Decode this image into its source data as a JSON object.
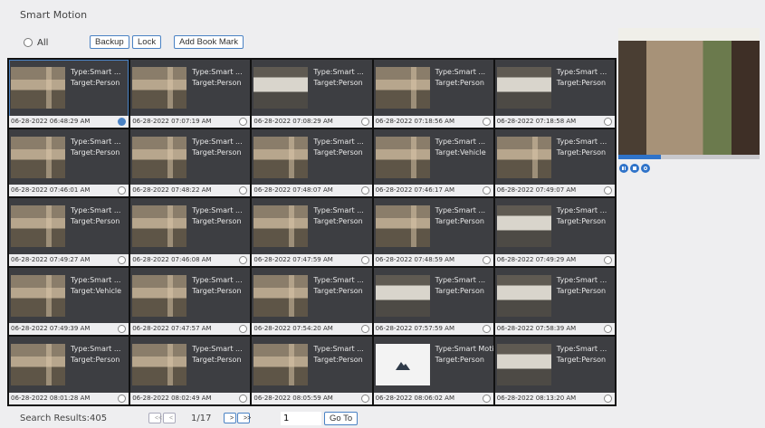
{
  "title": "Smart Motion",
  "toolbar": {
    "all_label": "All",
    "backup_label": "Backup",
    "lock_label": "Lock",
    "bookmark_label": "Add Book Mark"
  },
  "items": [
    {
      "thumb": "scene",
      "type": "Type:Smart ...",
      "target": "Target:Person",
      "ts": "06-28-2022 06:48:29 AM",
      "checked": true
    },
    {
      "thumb": "scene",
      "type": "Type:Smart ...",
      "target": "Target:Person",
      "ts": "06-28-2022 07:07:19 AM",
      "checked": false
    },
    {
      "thumb": "kitchen",
      "type": "Type:Smart ...",
      "target": "Target:Person",
      "ts": "06-28-2022 07:08:29 AM",
      "checked": false
    },
    {
      "thumb": "scene",
      "type": "Type:Smart ...",
      "target": "Target:Person",
      "ts": "06-28-2022 07:18:56 AM",
      "checked": false
    },
    {
      "thumb": "kitchen",
      "type": "Type:Smart ...",
      "target": "Target:Person",
      "ts": "06-28-2022 07:18:58 AM",
      "checked": false
    },
    {
      "thumb": "scene",
      "type": "Type:Smart ...",
      "target": "Target:Person",
      "ts": "06-28-2022 07:46:01 AM",
      "checked": false
    },
    {
      "thumb": "scene",
      "type": "Type:Smart ...",
      "target": "Target:Person",
      "ts": "06-28-2022 07:48:22 AM",
      "checked": false
    },
    {
      "thumb": "scene",
      "type": "Type:Smart ...",
      "target": "Target:Person",
      "ts": "06-28-2022 07:48:07 AM",
      "checked": false
    },
    {
      "thumb": "scene",
      "type": "Type:Smart ...",
      "target": "Target:Vehicle",
      "ts": "06-28-2022 07:46:17 AM",
      "checked": false
    },
    {
      "thumb": "scene",
      "type": "Type:Smart ...",
      "target": "Target:Person",
      "ts": "06-28-2022 07:49:07 AM",
      "checked": false
    },
    {
      "thumb": "scene",
      "type": "Type:Smart ...",
      "target": "Target:Person",
      "ts": "06-28-2022 07:49:27 AM",
      "checked": false
    },
    {
      "thumb": "scene",
      "type": "Type:Smart ...",
      "target": "Target:Person",
      "ts": "06-28-2022 07:46:08 AM",
      "checked": false
    },
    {
      "thumb": "scene",
      "type": "Type:Smart ...",
      "target": "Target:Person",
      "ts": "06-28-2022 07:47:59 AM",
      "checked": false
    },
    {
      "thumb": "scene",
      "type": "Type:Smart ...",
      "target": "Target:Person",
      "ts": "06-28-2022 07:48:59 AM",
      "checked": false
    },
    {
      "thumb": "kitchen",
      "type": "Type:Smart ...",
      "target": "Target:Person",
      "ts": "06-28-2022 07:49:29 AM",
      "checked": false
    },
    {
      "thumb": "scene",
      "type": "Type:Smart ...",
      "target": "Target:Vehicle",
      "ts": "06-28-2022 07:49:39 AM",
      "checked": false
    },
    {
      "thumb": "scene",
      "type": "Type:Smart ...",
      "target": "Target:Person",
      "ts": "06-28-2022 07:47:57 AM",
      "checked": false
    },
    {
      "thumb": "scene",
      "type": "Type:Smart ...",
      "target": "Target:Person",
      "ts": "06-28-2022 07:54:20 AM",
      "checked": false
    },
    {
      "thumb": "kitchen",
      "type": "Type:Smart ...",
      "target": "Target:Person",
      "ts": "06-28-2022 07:57:59 AM",
      "checked": false
    },
    {
      "thumb": "kitchen",
      "type": "Type:Smart ...",
      "target": "Target:Person",
      "ts": "06-28-2022 07:58:39 AM",
      "checked": false
    },
    {
      "thumb": "scene",
      "type": "Type:Smart ...",
      "target": "Target:Person",
      "ts": "06-28-2022 08:01:28 AM",
      "checked": false
    },
    {
      "thumb": "scene",
      "type": "Type:Smart ...",
      "target": "Target:Person",
      "ts": "06-28-2022 08:02:49 AM",
      "checked": false
    },
    {
      "thumb": "scene",
      "type": "Type:Smart ...",
      "target": "Target:Person",
      "ts": "06-28-2022 08:05:59 AM",
      "checked": false
    },
    {
      "thumb": "placeholder",
      "type": "Type:Smart Motion",
      "target": "Target:Person",
      "ts": "06-28-2022 08:06:02 AM",
      "checked": false
    },
    {
      "thumb": "kitchen",
      "type": "Type:Smart ...",
      "target": "Target:Person",
      "ts": "06-28-2022 08:13:20 AM",
      "checked": false
    }
  ],
  "preview": {
    "progress": 0.3
  },
  "footer": {
    "results": "Search Results:405",
    "first_label": "<<",
    "prev_label": "<",
    "page_info": "1/17",
    "next_label": ">",
    "last_label": ">>",
    "page_value": "1",
    "goto_label": "Go To"
  },
  "colors": {
    "accent": "#2f73c9",
    "cell_bg": "#3d3e42"
  }
}
